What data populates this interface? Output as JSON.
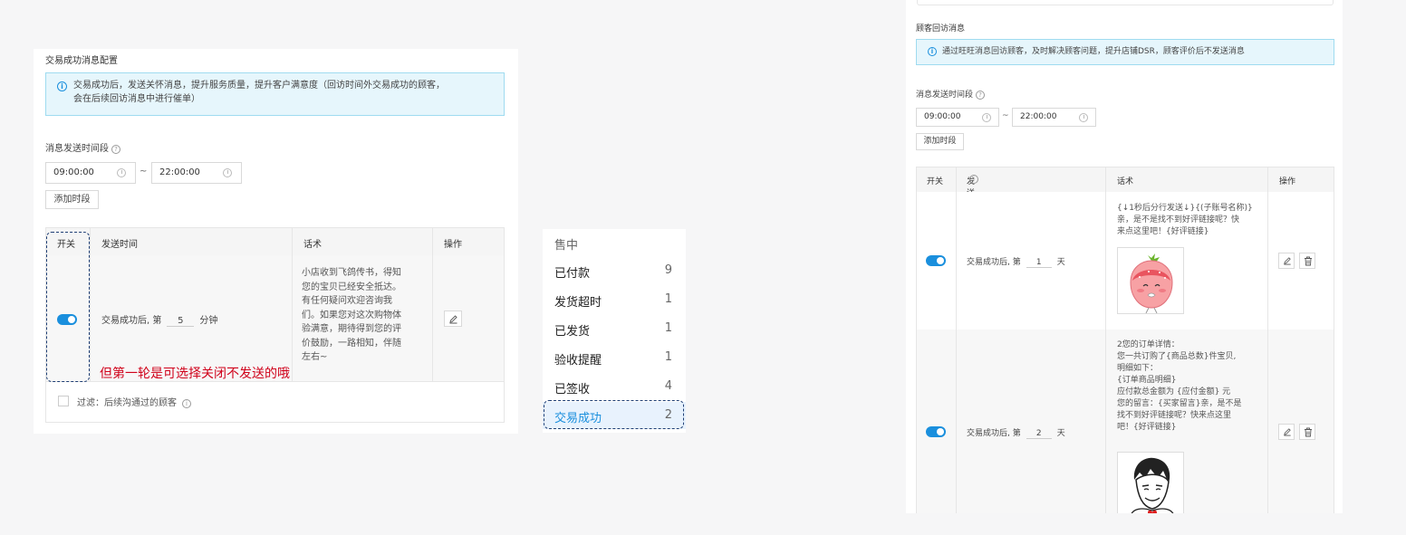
{
  "panel1": {
    "title": "交易成功消息配置",
    "alert_line1": "交易成功后，发送关怀消息，提升服务质量，提升客户满意度（回访时间外交易成功的顾客，",
    "alert_line2": "会在后续回访消息中进行催单）",
    "send_period_label": "消息发送时间段",
    "time_start": "09:00:00",
    "time_end": "22:00:00",
    "tilde": "~",
    "add_period_label": "添加时段",
    "columns": {
      "switch": "开关",
      "send_time": "发送时间",
      "script": "话术",
      "action": "操作"
    },
    "row": {
      "prefix": "交易成功后, 第",
      "value": "5",
      "unit": "分钟",
      "script_lines": [
        "小店收到飞鸽传书，得知",
        "您的宝贝已经安全抵达。",
        "有任何疑问欢迎咨询我",
        "们。如果您对这次购物体",
        "验满意，期待得到您的评",
        "价鼓励，一路相知，伴随",
        "左右~"
      ]
    },
    "filter_label": "过滤：后续沟通过的顾客",
    "annotation": "但第一轮是可选择关闭不发送的哦"
  },
  "status_list": {
    "header": "售中",
    "items": [
      {
        "label": "已付款",
        "count": "9"
      },
      {
        "label": "发货超时",
        "count": "1"
      },
      {
        "label": "已发货",
        "count": "1"
      },
      {
        "label": "验收提醒",
        "count": "1"
      },
      {
        "label": "已签收",
        "count": "4"
      },
      {
        "label": "交易成功",
        "count": "2"
      }
    ],
    "active_index": 5
  },
  "panel2": {
    "title": "顾客回访消息",
    "alert": "通过旺旺消息回访顾客，及时解决顾客问题，提升店铺DSR，顾客评价后不发送消息",
    "send_period_label": "消息发送时间段",
    "time_start": "09:00:00",
    "time_end": "22:00:00",
    "tilde": "~",
    "add_period_label": "添加时段",
    "columns": {
      "switch": "开关",
      "send_time": "发送时间",
      "script": "话术",
      "action": "操作"
    },
    "rows": [
      {
        "prefix": "交易成功后, 第",
        "value": "1",
        "unit": "天",
        "script_lines": [
          "{↓1秒后分行发送↓}{(子账号名称)}",
          "亲，是不是找不到好评链接呢？快",
          "来点这里吧！{好评链接}"
        ],
        "sticker": "strawberry-sticker"
      },
      {
        "prefix": "交易成功后, 第",
        "value": "2",
        "unit": "天",
        "script_lines": [
          "2您的订单详情：",
          "您一共订购了{商品总数}件宝贝,",
          "明细如下：",
          "{订单商品明细}",
          "应付款总金额为 {应付金额} 元",
          "您的留言：{买家留言}亲，是不是",
          "找不到好评链接呢？快来点这里",
          "吧！{好评链接}"
        ],
        "sticker": "meme-face-sticker"
      }
    ]
  },
  "colors": {
    "accent": "#1a8fdd",
    "annotation": "#d0021b",
    "dashed": "#1f3f75",
    "alert_bg": "#e6f6fc"
  }
}
